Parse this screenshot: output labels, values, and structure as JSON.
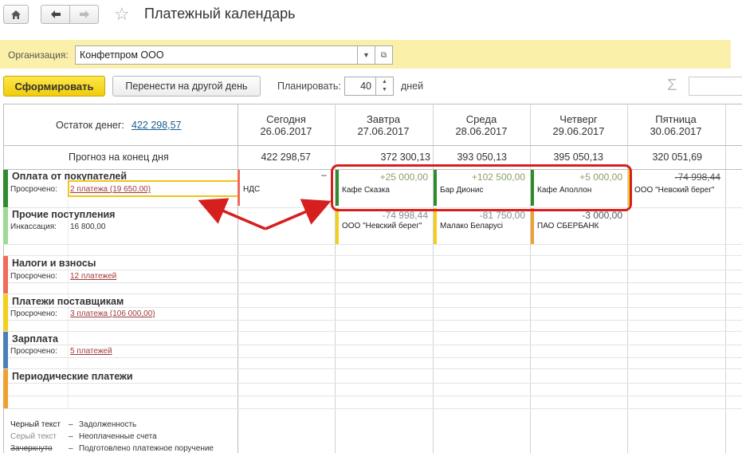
{
  "window": {
    "title": "Платежный календарь"
  },
  "icons": {
    "home": "home-icon",
    "back": "arrow-left-icon",
    "forward": "arrow-right-icon",
    "favorite": "star-icon",
    "dropdown": "chevron-down-icon",
    "open": "open-icon",
    "sum": "sigma-icon"
  },
  "organization": {
    "label": "Организация:",
    "value": "Конфетпром ООО"
  },
  "toolbar": {
    "generate_label": "Сформировать",
    "move_label": "Перенести на другой день",
    "plan_label": "Планировать:",
    "plan_value": "40",
    "plan_unit": "дней"
  },
  "balance": {
    "label": "Остаток денег:",
    "value": "422 298,57"
  },
  "forecast": {
    "label": "Прогноз на конец дня",
    "values": [
      "422 298,57",
      "372 300,13",
      "393 050,13",
      "395 050,13",
      "320 051,69"
    ]
  },
  "days": [
    {
      "name": "Сегодня",
      "date": "26.06.2017"
    },
    {
      "name": "Завтра",
      "date": "27.06.2017"
    },
    {
      "name": "Среда",
      "date": "28.06.2017"
    },
    {
      "name": "Четверг",
      "date": "29.06.2017"
    },
    {
      "name": "Пятница",
      "date": "30.06.2017"
    }
  ],
  "categories": [
    {
      "title": "Оплата от покупателей",
      "sub_label": "Просрочено:",
      "sub_link": "2 платежа (19 650,00)",
      "color": "#2e8b2e"
    },
    {
      "title": "Прочие поступления",
      "sub_label": "Инкассация:",
      "sub_value": "16 800,00",
      "color": "#9ed996"
    },
    {
      "title": "Налоги и взносы",
      "sub_label": "Просрочено:",
      "sub_link": "12 платежей",
      "color": "#ef6b5a"
    },
    {
      "title": "Платежи поставщикам",
      "sub_label": "Просрочено:",
      "sub_link": "3 платежа (106 000,00)",
      "color": "#f2cf1b"
    },
    {
      "title": "Зарплата",
      "sub_label": "Просрочено:",
      "sub_link": "5 платежей",
      "color": "#4a7fb8"
    },
    {
      "title": "Периодические платежи",
      "color": "#f0a030"
    }
  ],
  "today_cell": {
    "text": "НДС",
    "minus": "–"
  },
  "income_cells": [
    {
      "amount": "+25 000,00",
      "who": "Кафе Сказка"
    },
    {
      "amount": "+102 500,00",
      "who": "Бар Дионис"
    },
    {
      "amount": "+5 000,00",
      "who": "Кафе Аполлон"
    },
    {
      "amount": "-74 998,44",
      "who": "ООО \"Невский берег\""
    }
  ],
  "other_cells": [
    {
      "amount": "-74 998,44",
      "who": "ООО \"Невский берег\""
    },
    {
      "amount": "-81 750,00",
      "who": "Малако Беларусі"
    },
    {
      "amount": "-3 000,00",
      "who": "ПАО СБЕРБАНК"
    }
  ],
  "legend": [
    {
      "sample": "Черный текст",
      "dash": "–",
      "meaning": "Задолженность"
    },
    {
      "sample": "Серый текст",
      "dash": "–",
      "meaning": "Неоплаченные счета"
    },
    {
      "sample": "Зачеркнуто",
      "dash": "–",
      "meaning": "Подготовлено платежное поручение"
    }
  ],
  "colors": {
    "accent_yellow": "#f2cc0c",
    "annotation_red": "#d71f1f",
    "link": "#1c5d8e",
    "overdue_link": "#a03a3a",
    "income_green": "#2e8b2e",
    "supplier_yellow": "#f2cf1b",
    "other_orange": "#f0a030"
  }
}
